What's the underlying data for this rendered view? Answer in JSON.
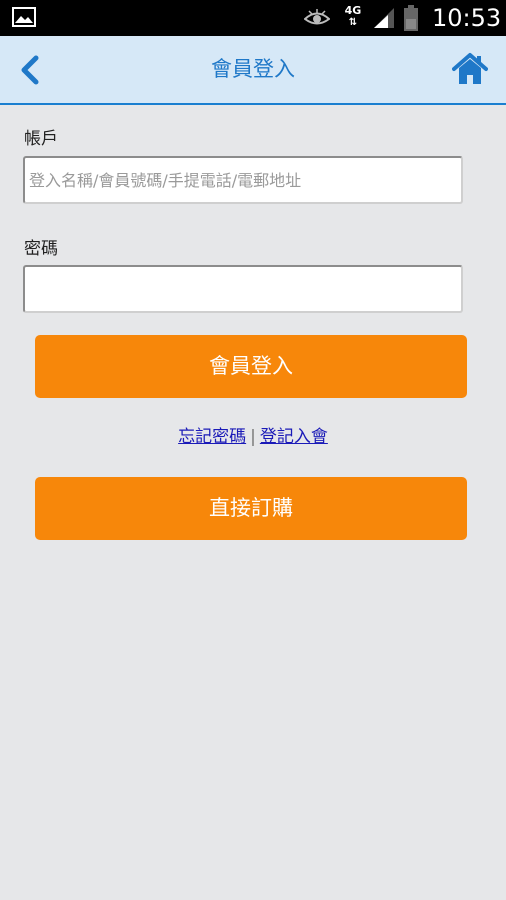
{
  "status_bar": {
    "time": "10:53",
    "network": "4G",
    "icons": [
      "gallery-icon",
      "eye-icon",
      "network-4g-icon",
      "signal-icon",
      "battery-icon"
    ]
  },
  "header": {
    "title": "會員登入",
    "back_icon": "chevron-left-icon",
    "home_icon": "home-icon",
    "background": "#d6e8f7",
    "accent": "#1f78c8"
  },
  "form": {
    "account_label": "帳戶",
    "account_value": "",
    "account_placeholder": "登入名稱/會員號碼/手提電話/電郵地址",
    "password_label": "密碼",
    "password_value": "",
    "password_placeholder": ""
  },
  "actions": {
    "login_label": "會員登入",
    "forgot_password_label": "忘記密碼",
    "separator": "|",
    "register_label": "登記入會",
    "direct_order_label": "直接訂購",
    "button_color": "#f7870a"
  }
}
